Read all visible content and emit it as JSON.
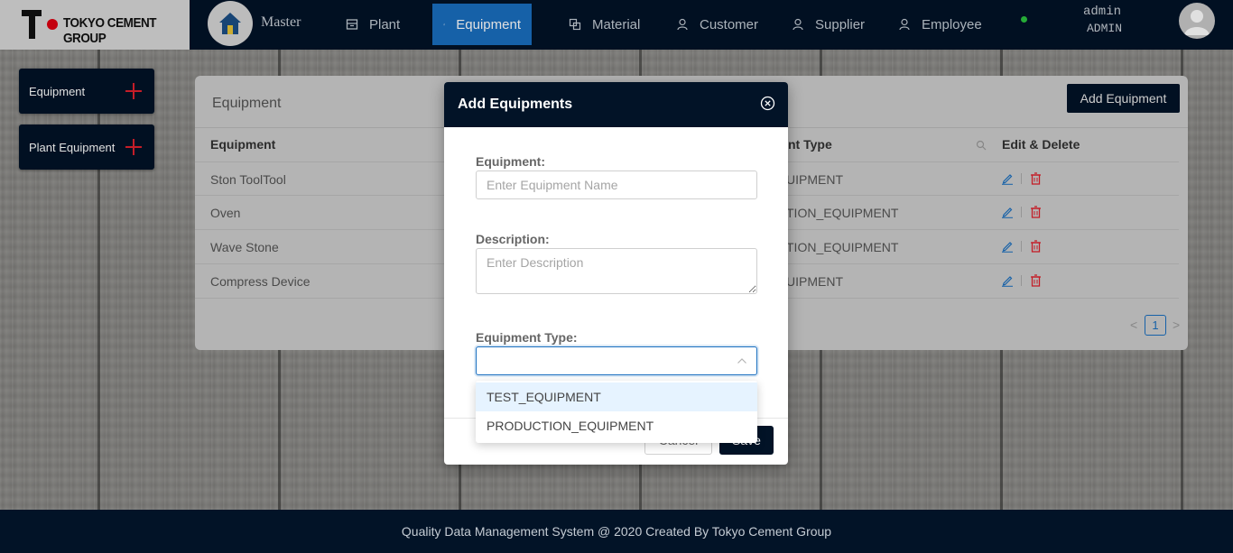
{
  "brand": {
    "logo_text": "TOKYO CEMENT GROUP"
  },
  "header": {
    "master_label": "Master",
    "nav": [
      {
        "label": "Plant",
        "icon": "building-icon"
      },
      {
        "label": "Equipment",
        "icon": "flask-icon",
        "active": true
      },
      {
        "label": "Material",
        "icon": "layers-icon"
      },
      {
        "label": "Customer",
        "icon": "user-icon"
      },
      {
        "label": "Supplier",
        "icon": "user-icon"
      },
      {
        "label": "Employee",
        "icon": "user-icon"
      }
    ],
    "user_name": "admin",
    "user_role": "ADMIN",
    "status_color": "#2bc33f"
  },
  "sidebar": {
    "items": [
      {
        "label": "Equipment"
      },
      {
        "label": "Plant Equipment"
      }
    ]
  },
  "main": {
    "card_title": "Equipment",
    "add_button": "Add Equipment",
    "columns": {
      "equipment": "Equipment",
      "type": "nt Type",
      "actions": "Edit & Delete"
    },
    "rows": [
      {
        "name": "Ston ToolTool",
        "type": "UIPMENT"
      },
      {
        "name": "Oven",
        "type": "TION_EQUIPMENT"
      },
      {
        "name": "Wave Stone",
        "type": "TION_EQUIPMENT"
      },
      {
        "name": "Compress Device",
        "type": "UIPMENT"
      }
    ],
    "pagination": {
      "current": "1",
      "prev": "<",
      "next": ">"
    }
  },
  "modal": {
    "title": "Add Equipments",
    "equipment_label": "Equipment:",
    "equipment_placeholder": "Enter Equipment Name",
    "description_label": "Description:",
    "description_placeholder": "Enter Description",
    "type_label": "Equipment Type:",
    "type_value": "",
    "type_options": [
      "TEST_EQUIPMENT",
      "PRODUCTION_EQUIPMENT"
    ],
    "cancel_label": "Cancel",
    "save_label": "Save"
  },
  "footer": {
    "text": "Quality Data Management System @ 2020 Created By Tokyo Cement Group"
  },
  "colors": {
    "navy": "#021327",
    "accent": "#1a6fc0",
    "danger": "#e0222e",
    "status_online": "#2bc33f"
  }
}
